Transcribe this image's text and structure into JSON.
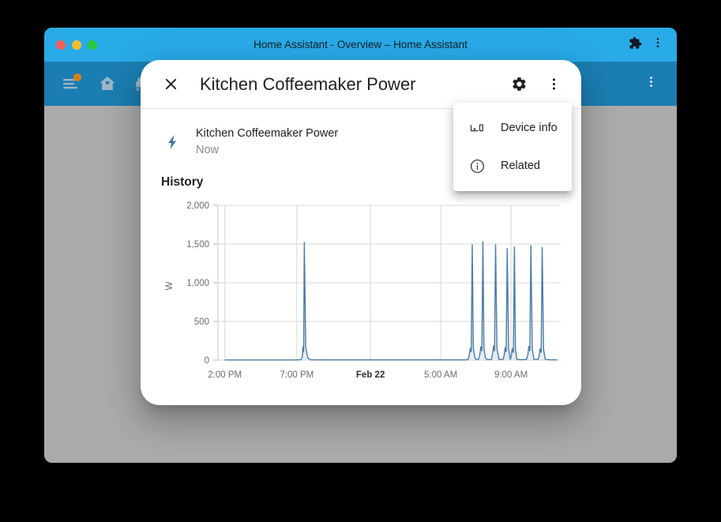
{
  "window": {
    "title": "Home Assistant - Overview – Home Assistant",
    "traffic_lights": [
      "close-red",
      "minimize-yellow",
      "maximize-green"
    ],
    "extensions_icon": "puzzle-piece-icon",
    "browser_menu_icon": "three-dot-menu-icon",
    "colors": {
      "titlebar": "#29abe8",
      "ha_toolbar": "#1b7eb3",
      "scrim": "#aaaaaa",
      "accent": "#44739e",
      "badge": "#d98015"
    }
  },
  "ha_toolbar": {
    "nav_items": [
      {
        "name": "menu",
        "icon": "hamburger-menu-icon",
        "badge": true
      },
      {
        "name": "home",
        "icon": "home-heart-icon",
        "badge": false
      },
      {
        "name": "living-room",
        "icon": "sofa-icon",
        "badge": false
      },
      {
        "name": "kitchen",
        "icon": "countertop-icon",
        "badge": false
      },
      {
        "name": "office",
        "icon": "desk-chair-icon",
        "badge": false
      },
      {
        "name": "vacuum-1",
        "icon": "robot-vacuum-icon",
        "badge": false
      },
      {
        "name": "vacuum-2",
        "icon": "robot-vacuum-alert-icon",
        "badge": false
      },
      {
        "name": "bedroom",
        "icon": "bed-icon",
        "badge": false
      },
      {
        "name": "garden",
        "icon": "flower-tulip-icon",
        "badge": false
      },
      {
        "name": "bathroom",
        "icon": "bathtub-icon",
        "badge": false
      },
      {
        "name": "energy",
        "icon": "transmission-tower-icon",
        "badge": false
      }
    ],
    "overflow_icon": "three-dot-menu-icon"
  },
  "dialog": {
    "title": "Kitchen Coffeemaker Power",
    "close_icon": "close-icon",
    "settings_icon": "gear-icon",
    "overflow_icon": "three-dot-menu-icon",
    "entity": {
      "icon": "lightning-bolt-icon",
      "name": "Kitchen Coffeemaker Power",
      "state": "Now"
    },
    "history_heading": "History"
  },
  "overflow_menu": {
    "items": [
      {
        "label": "Device info",
        "icon": "device-info-icon"
      },
      {
        "label": "Related",
        "icon": "info-circle-icon"
      }
    ]
  },
  "chart_data": {
    "type": "line",
    "title": "History",
    "xlabel": "",
    "ylabel": "W",
    "ylim": [
      0,
      2000
    ],
    "yticks": [
      0,
      500,
      1000,
      1500,
      2000
    ],
    "ytick_labels": [
      "0",
      "500",
      "1,000",
      "1,500",
      "2,000"
    ],
    "xtick_labels": [
      "2:00 PM",
      "7:00 PM",
      "Feb 22",
      "5:00 AM",
      "9:00 AM"
    ],
    "xtick_bold": [
      false,
      false,
      true,
      false,
      false
    ],
    "xtick_positions_pct": [
      2.0,
      23.0,
      44.5,
      65.0,
      85.5
    ],
    "grid": true,
    "legend": false,
    "line_color": "#4b7ba4",
    "fill_color": "#dde5ee",
    "series": [
      {
        "name": "Kitchen Coffeemaker Power",
        "unit": "W",
        "points_pct_x": [
          2.0,
          7.0,
          12.0,
          17.0,
          22.0,
          24.2,
          24.6,
          24.8,
          25.0,
          25.2,
          25.6,
          26.2,
          27.0,
          30.0,
          34.0,
          38.0,
          42.0,
          46.0,
          50.0,
          54.0,
          58.0,
          62.0,
          66.0,
          70.0,
          72.5,
          73.0,
          73.3,
          73.6,
          73.9,
          74.2,
          74.5,
          74.9,
          75.3,
          76.0,
          76.4,
          76.7,
          77.0,
          77.3,
          77.6,
          78.0,
          78.5,
          79.8,
          80.1,
          80.4,
          80.7,
          81.0,
          81.4,
          82.0,
          83.2,
          83.5,
          83.8,
          84.1,
          84.4,
          84.8,
          85.3,
          85.6,
          85.9,
          86.2,
          86.5,
          86.8,
          87.2,
          88.0,
          90.0,
          90.4,
          90.7,
          91.0,
          91.3,
          91.7,
          92.2,
          93.4,
          93.7,
          94.0,
          94.3,
          94.6,
          95.0,
          95.5,
          97.0,
          99.0
        ],
        "points_y": [
          2,
          2,
          2,
          2,
          2,
          4,
          40,
          170,
          110,
          1520,
          170,
          30,
          4,
          3,
          3,
          3,
          3,
          3,
          3,
          3,
          3,
          3,
          3,
          3,
          3,
          10,
          60,
          150,
          110,
          1490,
          160,
          40,
          6,
          8,
          70,
          170,
          120,
          1530,
          160,
          35,
          6,
          10,
          80,
          180,
          120,
          1490,
          150,
          8,
          8,
          60,
          160,
          110,
          1440,
          150,
          10,
          55,
          150,
          100,
          1460,
          140,
          10,
          6,
          8,
          60,
          175,
          120,
          1480,
          150,
          8,
          8,
          55,
          145,
          100,
          1455,
          140,
          8,
          4,
          3
        ]
      }
    ],
    "peaks": [
      {
        "time": "7:10 PM",
        "value": 1520
      },
      {
        "time": "8:05 AM",
        "value": 1490
      },
      {
        "time": "8:30 AM",
        "value": 1530
      },
      {
        "time": "9:05 AM",
        "value": 1490
      },
      {
        "time": "9:35 AM",
        "value": 1440
      },
      {
        "time": "9:55 AM",
        "value": 1460
      },
      {
        "time": "10:50 AM",
        "value": 1480
      },
      {
        "time": "11:25 AM",
        "value": 1455
      }
    ]
  }
}
